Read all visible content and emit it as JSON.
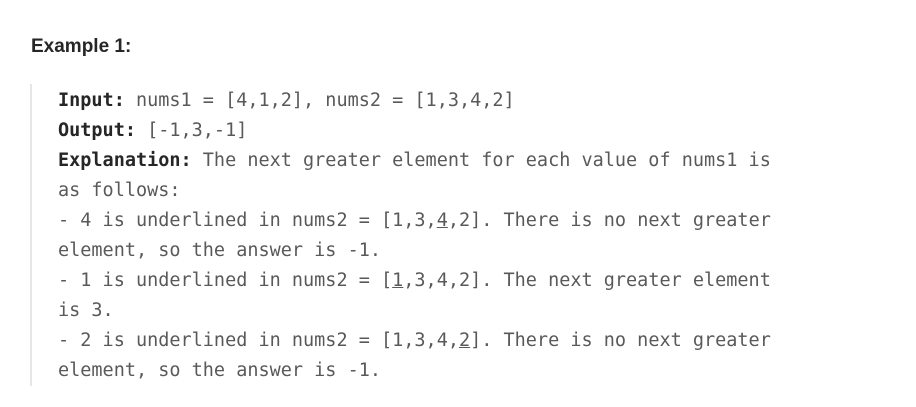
{
  "heading": "Example 1:",
  "input": {
    "label": "Input:",
    "value": " nums1 = [4,1,2], nums2 = [1,3,4,2]"
  },
  "output": {
    "label": "Output:",
    "value": " [-1,3,-1]"
  },
  "explanation": {
    "label": "Explanation:",
    "line1": " The next greater element for each value of nums1 is",
    "line2": "as follows:",
    "item1": {
      "before": "- 4 is underlined in nums2 = [1,3,",
      "underlined": "4",
      "after": ",2]. There is no next greater",
      "cont": "element, so the answer is -1."
    },
    "item2": {
      "before": "- 1 is underlined in nums2 = [",
      "underlined": "1",
      "after": ",3,4,2]. The next greater element",
      "cont": "is 3."
    },
    "item3": {
      "before": "- 2 is underlined in nums2 = [1,3,4,",
      "underlined": "2",
      "after": "]. There is no next greater",
      "cont": "element, so the answer is -1."
    }
  }
}
